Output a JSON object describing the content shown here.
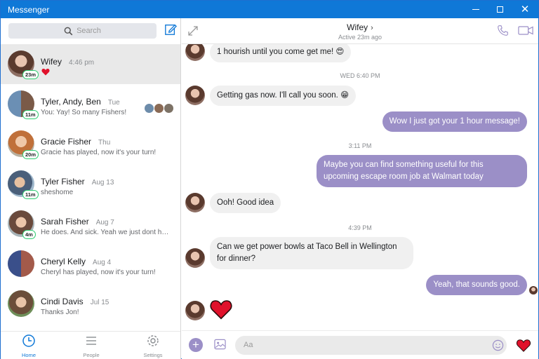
{
  "window": {
    "title": "Messenger"
  },
  "search": {
    "placeholder": "Search"
  },
  "conversations": [
    {
      "name": "Wifey",
      "time": "4:46 pm",
      "preview": "",
      "badge": "23m"
    },
    {
      "name": "Tyler, Andy, Ben",
      "time": "Tue",
      "preview": "You: Yay! So many Fishers!",
      "badge": "11m"
    },
    {
      "name": "Gracie Fisher",
      "time": "Thu",
      "preview": "Gracie has played, now it's your turn!",
      "badge": "20m"
    },
    {
      "name": "Tyler Fisher",
      "time": "Aug 13",
      "preview": "sheshome",
      "badge": "11m"
    },
    {
      "name": "Sarah Fisher",
      "time": "Aug 7",
      "preview": "He does. And sick. Yeah we just dont hear...",
      "badge": "4m"
    },
    {
      "name": "Cheryl Kelly",
      "time": "Aug 4",
      "preview": "Cheryl has played, now it's your turn!",
      "badge": ""
    },
    {
      "name": "Cindi Davis",
      "time": "Jul 15",
      "preview": "Thanks Jon!",
      "badge": ""
    }
  ],
  "nav": {
    "home": "Home",
    "people": "People",
    "settings": "Settings"
  },
  "chat": {
    "name": "Wifey",
    "status": "Active 23m ago",
    "messages": [
      {
        "dir": "in",
        "text": "1 hourish until you come get me! 😍"
      },
      {
        "type": "ts",
        "text": "WED 6:40 PM"
      },
      {
        "dir": "in",
        "text": "Getting gas now. I'll call you soon. 😁"
      },
      {
        "dir": "out",
        "text": "Wow I just got your 1 hour message!"
      },
      {
        "type": "ts",
        "text": "3:11 PM"
      },
      {
        "dir": "out",
        "text": "Maybe you can find something useful for this upcoming escape room job at Walmart today"
      },
      {
        "dir": "in",
        "text": "Ooh! Good idea"
      },
      {
        "type": "ts",
        "text": "4:39 PM"
      },
      {
        "dir": "in",
        "text": "Can we get power bowls at Taco Bell in Wellington for dinner?"
      },
      {
        "dir": "out",
        "text": "Yeah, that sounds good."
      }
    ]
  },
  "composer": {
    "placeholder": "Aa"
  },
  "colors": {
    "titlebar": "#0f78d7",
    "accent": "#9b8fc7",
    "heart": "#e0112b",
    "active_badge": "#2ecc71"
  },
  "icons": [
    "search-icon",
    "compose-icon",
    "expand-icon",
    "phone-icon",
    "video-icon",
    "plus-icon",
    "image-icon",
    "emoji-icon",
    "heart-icon",
    "home-icon",
    "people-icon",
    "settings-icon"
  ]
}
